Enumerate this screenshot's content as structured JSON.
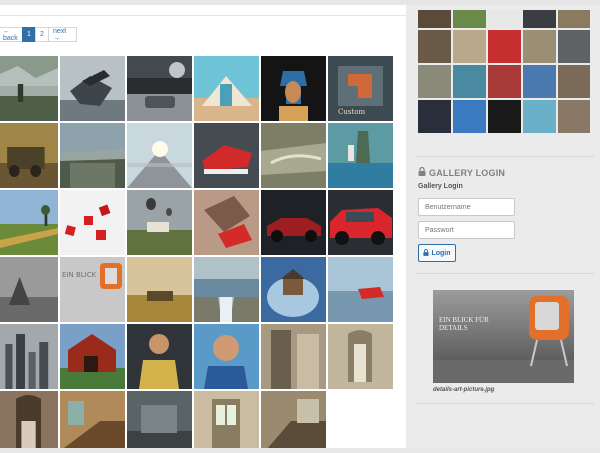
{
  "pagination": {
    "back_label": "← back",
    "pages": [
      "1",
      "2"
    ],
    "active_page": "1",
    "next_label": "next →"
  },
  "gallery": {
    "tiles": [
      "misty-forest-rider",
      "robot-bird",
      "sinking-car-street",
      "open-book-door-sea",
      "nefertiti-bust",
      "custom-work-tile",
      "military-truck",
      "cliff-island",
      "road-to-light",
      "red-sneaker",
      "river-lake-aerial",
      "woman-shore-lake",
      "cracked-field-tree",
      "red-dice",
      "balloons-over-field",
      "red-sneaker-crash",
      "vintage-car",
      "red-suv",
      "grey-misty-trees",
      "blick-fuer-details",
      "harvest-field",
      "dam-waterfall",
      "house-in-globe",
      "red-car-lake",
      "city-skyline-fog",
      "red-barn",
      "man-with-cat-shirt",
      "man-blue-shirt",
      "abandoned-corridor",
      "ornate-hallway",
      "abandoned-stairs",
      "abandoned-staircase",
      "ruined-room",
      "abandoned-door",
      "old-staircase"
    ]
  },
  "sidebar": {
    "thumbs": [
      "dark-frame",
      "green-hill",
      "red-dice-small",
      "dark-street",
      "hall-small",
      "stairs-arch",
      "hallway-2",
      "red-sneaker-small",
      "door-frame",
      "grey-room",
      "curved-road",
      "cliff-tile",
      "red-car-small",
      "portrait-man",
      "abandoned-room",
      "night-figure",
      "blue-box",
      "nefertiti-small",
      "open-book-small",
      "abandoned-hall"
    ],
    "login": {
      "heading": "GALLERY LOGIN",
      "subheading": "Gallery Login",
      "username_placeholder": "Benutzername",
      "password_placeholder": "Passwort",
      "button_label": "Login"
    },
    "featured": {
      "headline": "EIN BLICK FÜR DETAILS",
      "caption": "details-art-picture.jpg"
    }
  },
  "colors": {
    "accent": "#2f6ea7",
    "page_bg": "#f0f0f0",
    "sidebar_bg": "#ebebeb",
    "heading_grey": "#808080"
  }
}
